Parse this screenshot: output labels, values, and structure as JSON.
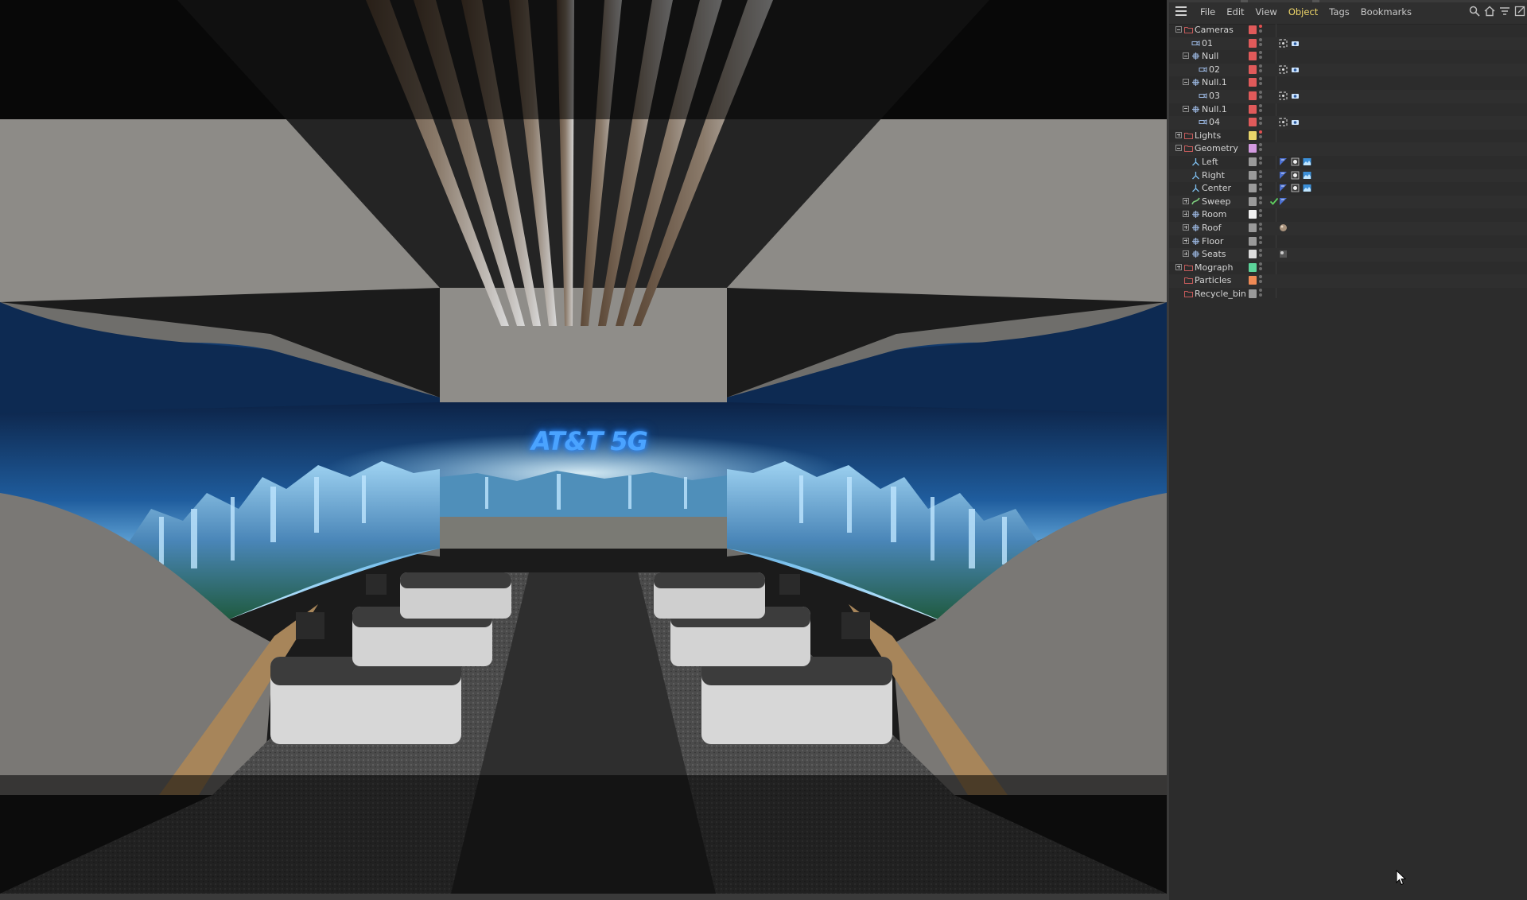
{
  "viewport": {
    "brand_text": "AT&T 5G"
  },
  "menu": {
    "items": [
      "File",
      "Edit",
      "View",
      "Object",
      "Tags",
      "Bookmarks"
    ],
    "active": "Object"
  },
  "toolbar_icons": [
    "search-icon",
    "home-icon",
    "filter-icon",
    "expand-icon"
  ],
  "colors": {
    "red": "#e05a5a",
    "yellow": "#e8d46a",
    "pink": "#d39ae0",
    "gray": "#9a9a9a",
    "white": "#f0f0f0",
    "green": "#5cd49a",
    "orange": "#f08a55",
    "active_menu": "#f1d86a"
  },
  "objects": [
    {
      "name": "Cameras",
      "depth": 0,
      "expander": "minus",
      "icon": "folder-icon",
      "color": "#e05a5a",
      "dot": "red"
    },
    {
      "name": "01",
      "depth": 1,
      "expander": "",
      "icon": "camera-icon",
      "color": "#e05a5a",
      "tags": [
        "target-tag-icon",
        "camera-tag-icon"
      ]
    },
    {
      "name": "Null",
      "depth": 1,
      "expander": "minus",
      "icon": "null-icon",
      "color": "#e05a5a"
    },
    {
      "name": "02",
      "depth": 2,
      "expander": "",
      "icon": "camera-icon",
      "color": "#e05a5a",
      "tags": [
        "target-tag-icon",
        "camera-tag-icon"
      ]
    },
    {
      "name": "Null.1",
      "depth": 1,
      "expander": "minus",
      "icon": "null-icon",
      "color": "#e05a5a"
    },
    {
      "name": "03",
      "depth": 2,
      "expander": "",
      "icon": "camera-icon",
      "color": "#e05a5a",
      "tags": [
        "target-tag-icon",
        "camera-tag-icon"
      ]
    },
    {
      "name": "Null.1",
      "depth": 1,
      "expander": "minus",
      "icon": "null-icon",
      "color": "#e05a5a"
    },
    {
      "name": "04",
      "depth": 2,
      "expander": "",
      "icon": "camera-icon",
      "color": "#e05a5a",
      "tags": [
        "target-tag-icon",
        "camera-tag-icon"
      ]
    },
    {
      "name": "Lights",
      "depth": 0,
      "expander": "plus",
      "icon": "folder-icon",
      "color": "#e8d46a",
      "dot": "red"
    },
    {
      "name": "Geometry",
      "depth": 0,
      "expander": "minus",
      "icon": "folder-icon",
      "color": "#d39ae0"
    },
    {
      "name": "Left",
      "depth": 1,
      "expander": "",
      "icon": "joint-icon",
      "color": "#9a9a9a",
      "tags": [
        "uv-tag-icon",
        "phong-tag-icon",
        "texture-tag-icon"
      ]
    },
    {
      "name": "Right",
      "depth": 1,
      "expander": "",
      "icon": "joint-icon",
      "color": "#9a9a9a",
      "tags": [
        "uv-tag-icon",
        "phong-tag-icon",
        "texture-tag-icon"
      ]
    },
    {
      "name": "Center",
      "depth": 1,
      "expander": "",
      "icon": "joint-icon",
      "color": "#9a9a9a",
      "tags": [
        "uv-tag-icon",
        "phong-tag-icon",
        "texture-tag-icon"
      ]
    },
    {
      "name": "Sweep",
      "depth": 1,
      "expander": "plus",
      "icon": "sweep-icon",
      "color": "#9a9a9a",
      "check": true,
      "tags": [
        "uv-tag-icon"
      ]
    },
    {
      "name": "Room",
      "depth": 1,
      "expander": "plus",
      "icon": "null-icon",
      "color": "#f0f0f0"
    },
    {
      "name": "Roof",
      "depth": 1,
      "expander": "plus",
      "icon": "null-icon",
      "color": "#9a9a9a",
      "tags": [
        "material-sphere-icon"
      ]
    },
    {
      "name": "Floor",
      "depth": 1,
      "expander": "plus",
      "icon": "null-icon",
      "color": "#9a9a9a"
    },
    {
      "name": "Seats",
      "depth": 1,
      "expander": "plus",
      "icon": "null-icon",
      "color": "#dcdcdc",
      "tags": [
        "material-dark-icon"
      ]
    },
    {
      "name": "Mograph",
      "depth": 0,
      "expander": "plus",
      "icon": "folder-icon",
      "color": "#5cd49a"
    },
    {
      "name": "Particles",
      "depth": 0,
      "expander": "",
      "icon": "folder-icon",
      "color": "#f08a55"
    },
    {
      "name": "Recycle_bin",
      "depth": 0,
      "expander": "",
      "icon": "folder-icon",
      "color": "#9a9a9a"
    }
  ]
}
